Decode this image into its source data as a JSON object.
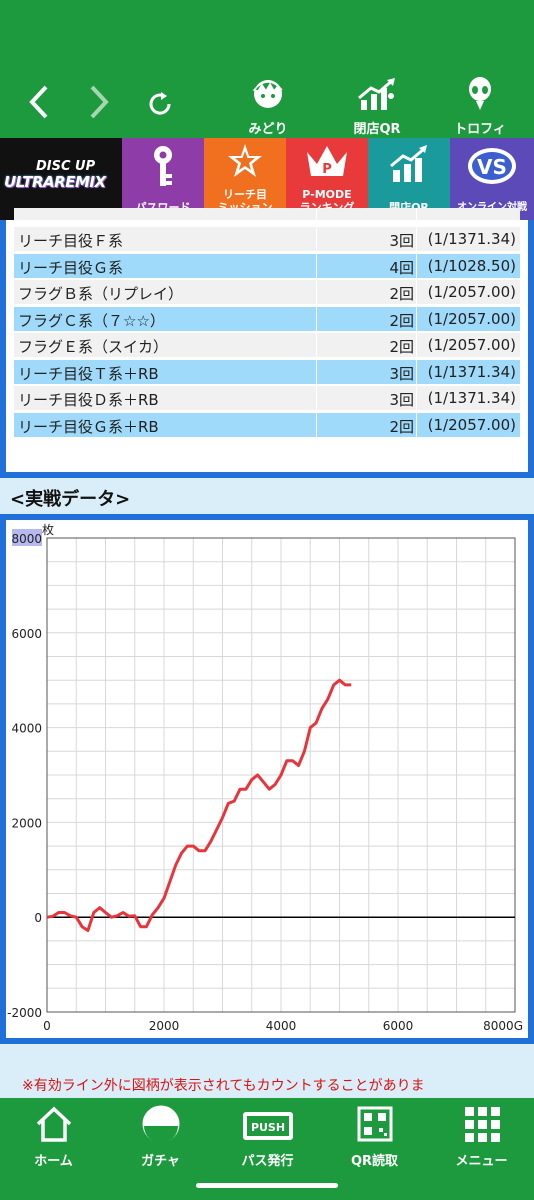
{
  "topbar": {
    "icons": [
      {
        "label": "みどり",
        "icon": "midori-character-icon"
      },
      {
        "label": "閉店QR",
        "icon": "chart-up-qr-icon"
      },
      {
        "label": "トロフィー",
        "icon": "alien-trophy-icon"
      }
    ]
  },
  "menu": {
    "logo_line1": "DISC UP",
    "logo_line2": "ULTRAREMIX",
    "tiles": [
      {
        "label": "パスワード",
        "color": "#8e3ca8"
      },
      {
        "label1": "リーチ目",
        "label2": "ミッション",
        "color": "#f07020"
      },
      {
        "label1": "P-MODE",
        "label2": "ランキング",
        "color": "#e83a3a"
      },
      {
        "label": "閉店QR",
        "color": "#1a9a9a"
      },
      {
        "label": "オンライン対戦",
        "color": "#5b4ab8"
      }
    ]
  },
  "table": {
    "rows": [
      {
        "name": "リーチ目役Ｆ系",
        "count": "3回",
        "prob": "(1/1371.34)"
      },
      {
        "name": "リーチ目役Ｇ系",
        "count": "4回",
        "prob": "(1/1028.50)"
      },
      {
        "name": "フラグＢ系（リプレイ）",
        "count": "2回",
        "prob": "(1/2057.00)"
      },
      {
        "name": "フラグＣ系（７☆☆）",
        "count": "2回",
        "prob": "(1/2057.00)"
      },
      {
        "name": "フラグＥ系（スイカ）",
        "count": "2回",
        "prob": "(1/2057.00)"
      },
      {
        "name": "リーチ目役Ｔ系＋RB",
        "count": "3回",
        "prob": "(1/1371.34)"
      },
      {
        "name": "リーチ目役Ｄ系＋RB",
        "count": "3回",
        "prob": "(1/1371.34)"
      },
      {
        "name": "リーチ目役Ｇ系＋RB",
        "count": "2回",
        "prob": "(1/2057.00)"
      }
    ]
  },
  "section_title": "<実戦データ>",
  "chart_data": {
    "type": "line",
    "ylabel": "枚",
    "xlim": [
      0,
      8000
    ],
    "ylim": [
      -2000,
      8000
    ],
    "x_ticks": [
      "0",
      "2000",
      "4000",
      "6000",
      "8000G"
    ],
    "y_ticks": [
      "8000",
      "6000",
      "4000",
      "2000",
      "0",
      "-2000"
    ],
    "grid": true,
    "series": [
      {
        "color": "#e8343a",
        "x": [
          0,
          100,
          200,
          300,
          400,
          500,
          600,
          700,
          800,
          900,
          1000,
          1100,
          1200,
          1300,
          1400,
          1500,
          1600,
          1700,
          1800,
          1900,
          2000,
          2100,
          2200,
          2300,
          2400,
          2500,
          2600,
          2700,
          2800,
          2900,
          3000,
          3100,
          3200,
          3300,
          3400,
          3500,
          3600,
          3700,
          3800,
          3900,
          4000,
          4100,
          4200,
          4300,
          4400,
          4500,
          4600,
          4700,
          4800,
          4900,
          5000,
          5100,
          5200
        ],
        "y": [
          0,
          20,
          100,
          100,
          30,
          0,
          -200,
          -280,
          100,
          200,
          100,
          0,
          30,
          100,
          20,
          30,
          -200,
          -200,
          50,
          200,
          400,
          750,
          1100,
          1350,
          1500,
          1500,
          1400,
          1400,
          1600,
          1850,
          2100,
          2400,
          2450,
          2700,
          2700,
          2900,
          3000,
          2850,
          2700,
          2800,
          3000,
          3300,
          3300,
          3200,
          3500,
          4000,
          4100,
          4400,
          4600,
          4900,
          5000,
          4900,
          4900
        ]
      }
    ]
  },
  "note": "※有効ライン外に図柄が表示されてもカウントすることがありま",
  "bottombar": {
    "items": [
      {
        "label": "ホーム"
      },
      {
        "label": "ガチャ"
      },
      {
        "label": "パス発行",
        "badge": "PUSH"
      },
      {
        "label": "QR読取"
      },
      {
        "label": "メニュー"
      }
    ]
  }
}
